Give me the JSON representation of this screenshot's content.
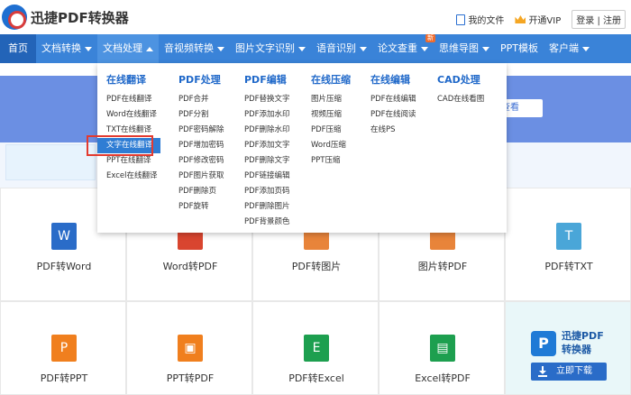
{
  "header": {
    "brand": "迅捷PDF转换器",
    "links": [
      "我的文件",
      "开通VIP",
      "登录 | 注册"
    ]
  },
  "nav": {
    "items": [
      "首页",
      "文档转换",
      "文档处理",
      "音视频转换",
      "图片文字识别",
      "语音识别",
      "论文查重",
      "思维导图",
      "PPT模板",
      "客户端"
    ],
    "badge": "新"
  },
  "banner": {
    "button_text": "查看"
  },
  "dropdown": {
    "columns": [
      {
        "title": "在线翻译",
        "items": [
          "PDF在线翻译",
          "Word在线翻译",
          "TXT在线翻译",
          "文字在线翻译",
          "PPT在线翻译",
          "Excel在线翻译"
        ]
      },
      {
        "title": "PDF处理",
        "items": [
          "PDF合并",
          "PDF分割",
          "PDF密码解除",
          "PDF增加密码",
          "PDF修改密码",
          "PDF图片获取",
          "PDF删除页",
          "PDF旋转"
        ]
      },
      {
        "title": "PDF编辑",
        "items": [
          "PDF替换文字",
          "PDF添加水印",
          "PDF删除水印",
          "PDF添加文字",
          "PDF删除文字",
          "PDF链接编辑",
          "PDF添加页码",
          "PDF删除图片",
          "PDF背景颜色"
        ]
      },
      {
        "title": "在线压缩",
        "items": [
          "图片压缩",
          "视频压缩",
          "PDF压缩",
          "Word压缩",
          "PPT压缩"
        ]
      },
      {
        "title": "在线编辑",
        "items": [
          "PDF在线编辑",
          "PDF在线阅读",
          "在线PS"
        ]
      },
      {
        "title": "CAD处理",
        "items": [
          "CAD在线看图"
        ]
      }
    ],
    "selected": "文字在线翻译"
  },
  "tiles": {
    "row1": [
      {
        "label": "PDF转Word",
        "icon": "W",
        "color": "#2a6cc8"
      },
      {
        "label": "Word转PDF",
        "icon": "",
        "color": "#d9452f"
      },
      {
        "label": "PDF转图片",
        "icon": "",
        "color": "#e8843a"
      },
      {
        "label": "图片转PDF",
        "icon": "",
        "color": "#e8843a"
      },
      {
        "label": "PDF转TXT",
        "icon": "T",
        "color": "#4aa6d8"
      }
    ],
    "row2": [
      {
        "label": "PDF转PPT",
        "icon": "P",
        "color": "#f07f1e"
      },
      {
        "label": "PPT转PDF",
        "icon": "▣",
        "color": "#f07f1e"
      },
      {
        "label": "PDF转Excel",
        "icon": "E",
        "color": "#1d9f4f"
      },
      {
        "label": "Excel转PDF",
        "icon": "▤",
        "color": "#1d9f4f"
      }
    ]
  },
  "promo": {
    "name_line1": "迅捷PDF",
    "name_line2": "转换器",
    "logo": "P",
    "download": "立即下载"
  }
}
